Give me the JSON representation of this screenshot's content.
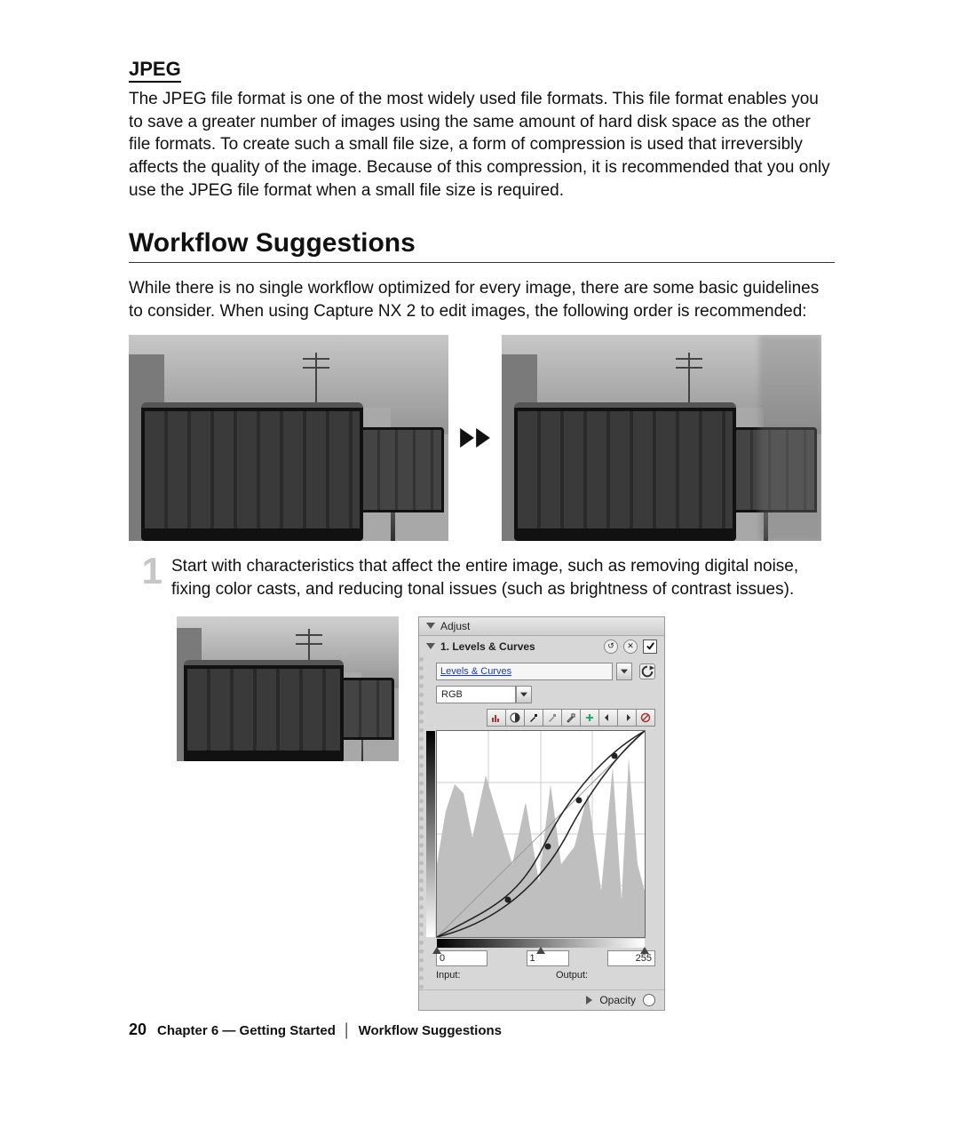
{
  "jpeg_section": {
    "heading": "JPEG",
    "body": "The JPEG file format is one of the most widely used file formats. This file format enables you to save a greater number of images using the same amount of hard disk space as the other file formats. To create such a small file size, a form of compression is used that irreversibly affects the quality of the image. Because of this compression, it is recommended that you only use the JPEG file format when a small file size is required."
  },
  "workflow": {
    "heading": "Workflow Suggestions",
    "intro": "While there is no single workflow optimized for every image, there are some basic guidelines to consider. When using Capture NX 2 to edit images, the following order is recommended:",
    "step1": {
      "num": "1",
      "text": "Start with characteristics that affect the entire image, such as removing digital noise, fixing color casts, and reducing tonal issues (such as brightness of contrast issues)."
    }
  },
  "panel": {
    "header": "Adjust",
    "section_title": "1. Levels & Curves",
    "dropdown_label": "Levels & Curves",
    "channel": "RGB",
    "checked": true,
    "sliders": {
      "black": "0",
      "gamma": "1",
      "white": "255"
    },
    "labels": {
      "input": "Input:",
      "output": "Output:"
    },
    "opacity_label": "Opacity"
  },
  "footer": {
    "page_number": "20",
    "chapter": "Chapter 6 — Getting Started",
    "section": "Workflow Suggestions"
  }
}
